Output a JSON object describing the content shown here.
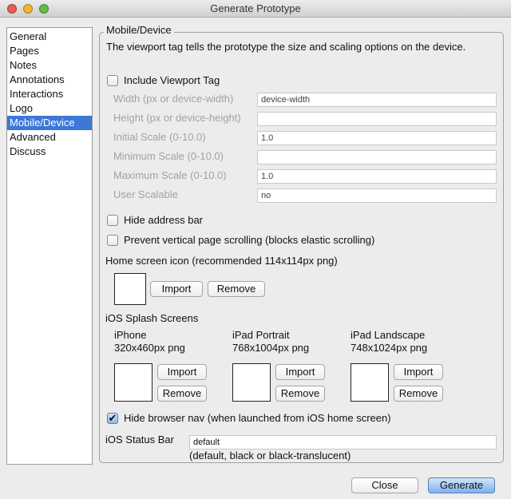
{
  "window": {
    "title": "Generate Prototype"
  },
  "sidebar": {
    "items": [
      {
        "label": "General"
      },
      {
        "label": "Pages"
      },
      {
        "label": "Notes"
      },
      {
        "label": "Annotations"
      },
      {
        "label": "Interactions"
      },
      {
        "label": "Logo"
      },
      {
        "label": "Mobile/Device",
        "selected": true
      },
      {
        "label": "Advanced"
      },
      {
        "label": "Discuss"
      }
    ]
  },
  "panel": {
    "legend": "Mobile/Device",
    "description": "The viewport tag tells the prototype the size and scaling options on the device.",
    "include_viewport": {
      "label": "Include Viewport Tag",
      "checked": false
    },
    "fields": [
      {
        "label": "Width (px or device-width)",
        "value": "device-width"
      },
      {
        "label": "Height (px or device-height)",
        "value": ""
      },
      {
        "label": "Initial Scale (0-10.0)",
        "value": "1.0"
      },
      {
        "label": "Minimum Scale (0-10.0)",
        "value": ""
      },
      {
        "label": "Maximum Scale (0-10.0)",
        "value": "1.0"
      },
      {
        "label": "User Scalable",
        "value": "no"
      }
    ],
    "hide_address_bar": {
      "label": "Hide address bar",
      "checked": false
    },
    "prevent_scroll": {
      "label": "Prevent vertical page scrolling (blocks elastic scrolling)",
      "checked": false
    },
    "home_icon": {
      "label": "Home screen icon (recommended 114x114px png)",
      "import": "Import",
      "remove": "Remove"
    },
    "splash": {
      "label": "iOS Splash Screens",
      "items": [
        {
          "name": "iPhone",
          "size": "320x460px png",
          "import": "Import",
          "remove": "Remove"
        },
        {
          "name": "iPad Portrait",
          "size": "768x1004px png",
          "import": "Import",
          "remove": "Remove"
        },
        {
          "name": "iPad Landscape",
          "size": "748x1024px png",
          "import": "Import",
          "remove": "Remove"
        }
      ]
    },
    "hide_browser_nav": {
      "label": "Hide browser nav (when launched from iOS home screen)",
      "checked": true,
      "mark": "✔"
    },
    "status_bar": {
      "label": "iOS Status Bar",
      "value": "default",
      "hint": "(default, black or black-translucent)"
    }
  },
  "footer": {
    "close": "Close",
    "generate": "Generate"
  }
}
